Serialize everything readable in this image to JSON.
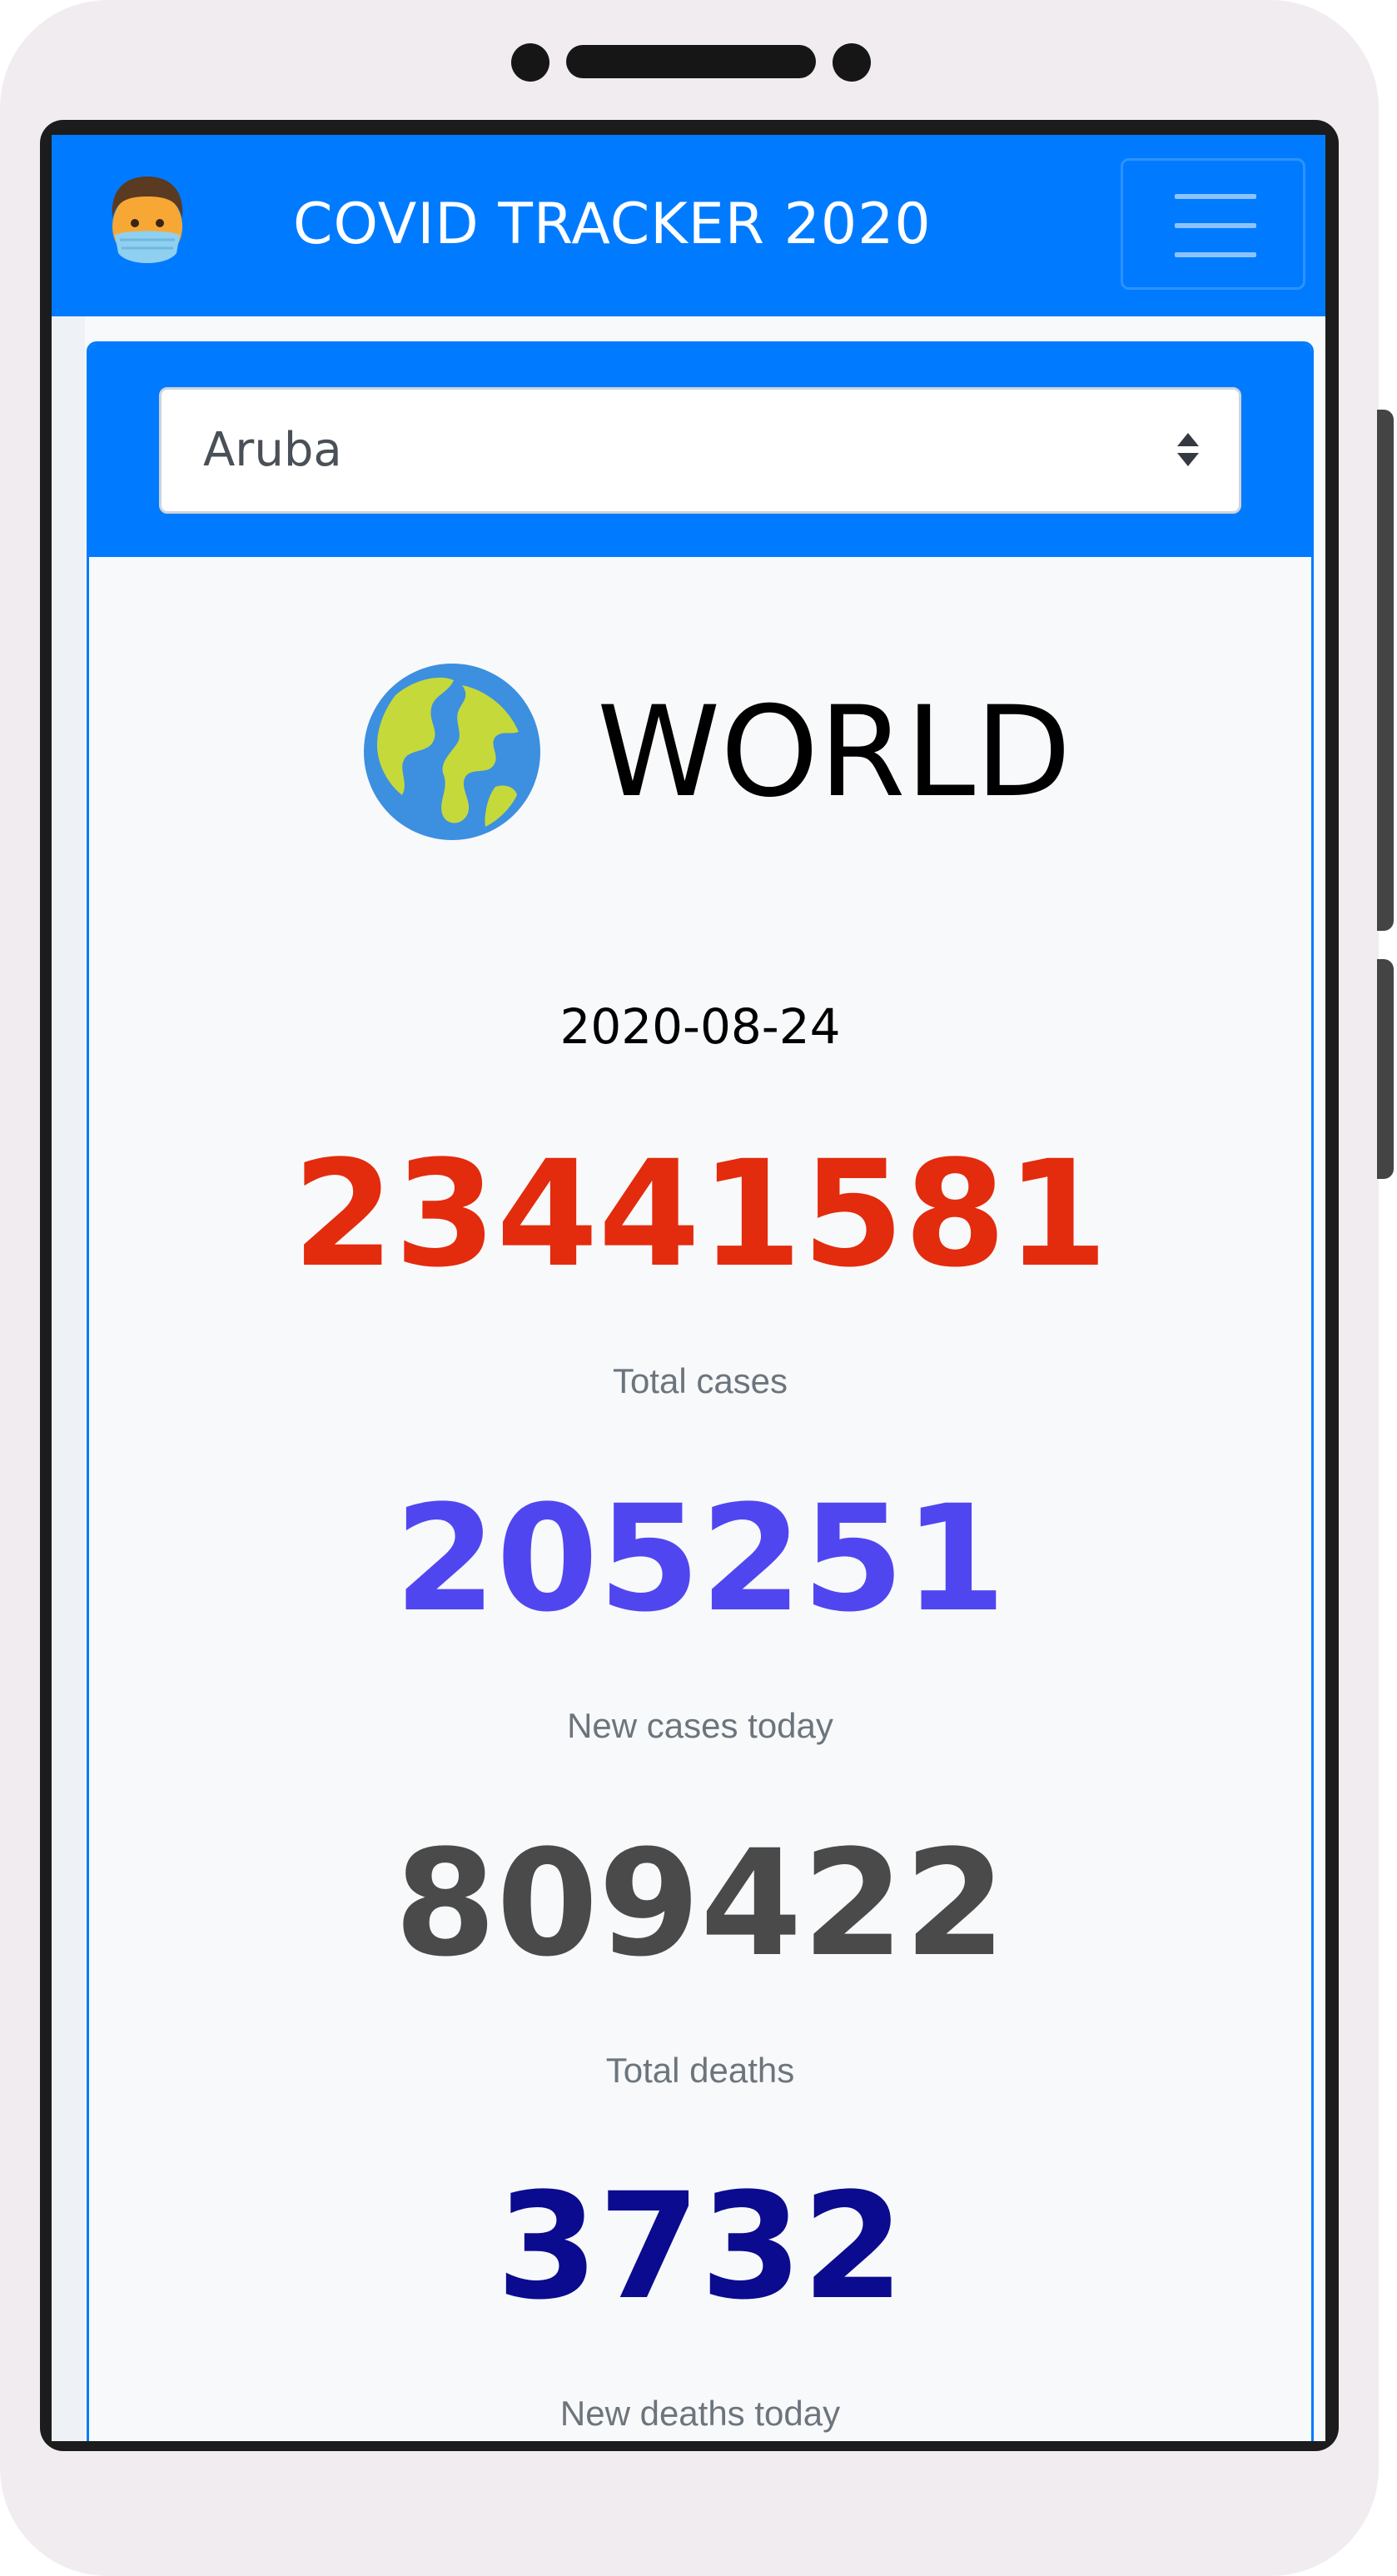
{
  "navbar": {
    "title": "COVID TRACKER 2020",
    "brand_icon": "masked-face-icon",
    "menu_icon": "hamburger-menu-icon"
  },
  "country_select": {
    "selected": "Aruba",
    "icon": "select-arrows-icon"
  },
  "summary": {
    "region_icon": "globe-icon",
    "region": "WORLD",
    "date": "2020-08-24",
    "stats": [
      {
        "value": "23441581",
        "label": "Total cases",
        "color": "#e32b0e"
      },
      {
        "value": "205251",
        "label": "New cases today",
        "color": "#5046f0"
      },
      {
        "value": "809422",
        "label": "Total deaths",
        "color": "#4a4a4a"
      },
      {
        "value": "3732",
        "label": "New deaths today",
        "color": "#0b0b8f"
      }
    ]
  },
  "colors": {
    "primary": "#007bff",
    "label_gray": "#6c757d"
  }
}
